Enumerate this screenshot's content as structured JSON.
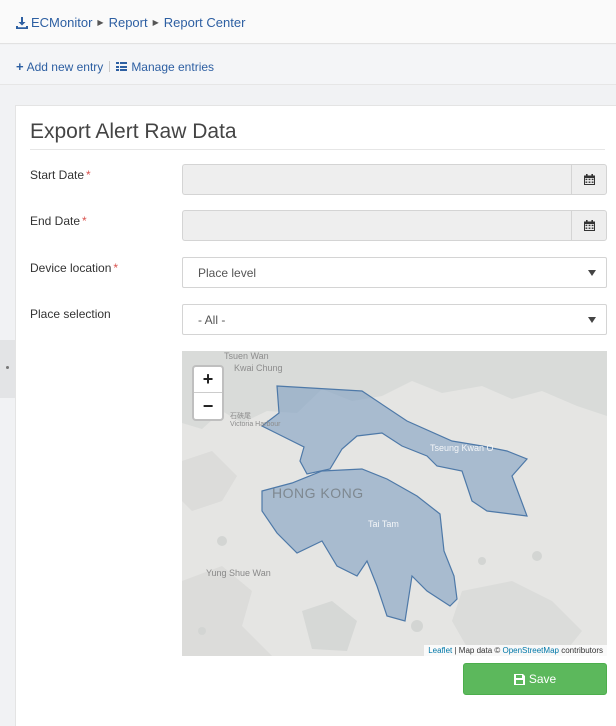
{
  "breadcrumb": {
    "items": [
      "ECMonitor",
      "Report",
      "Report Center"
    ]
  },
  "actions": {
    "add": "Add new entry",
    "manage": "Manage entries"
  },
  "form": {
    "title": "Export Alert Raw Data",
    "required_mark": "*",
    "start_date": {
      "label": "Start Date",
      "value": ""
    },
    "end_date": {
      "label": "End Date",
      "value": ""
    },
    "device_location": {
      "label": "Device location",
      "selected": "Place level"
    },
    "place_selection": {
      "label": "Place selection",
      "selected": "- All -"
    },
    "save_label": "Save"
  },
  "map": {
    "labels": {
      "tsuen_wan": "Tsuen Wan",
      "kwai_chung": "Kwai Chung",
      "shek_kip": "石硤尾",
      "victoria": "Victoria Harbour",
      "tseung_kwan_o": "Tseung Kwan O",
      "hong_kong": "HONG KONG",
      "tai_tam": "Tai Tam",
      "yung_shue_wan": "Yung Shue Wan"
    },
    "zoom_in": "+",
    "zoom_out": "−",
    "attribution": {
      "leaflet": "Leaflet",
      "sep": " | Map data © ",
      "osm": "OpenStreetMap",
      "suffix": " contributors"
    },
    "region_fill": "#7f9fc2",
    "region_stroke": "#4e79a8"
  }
}
